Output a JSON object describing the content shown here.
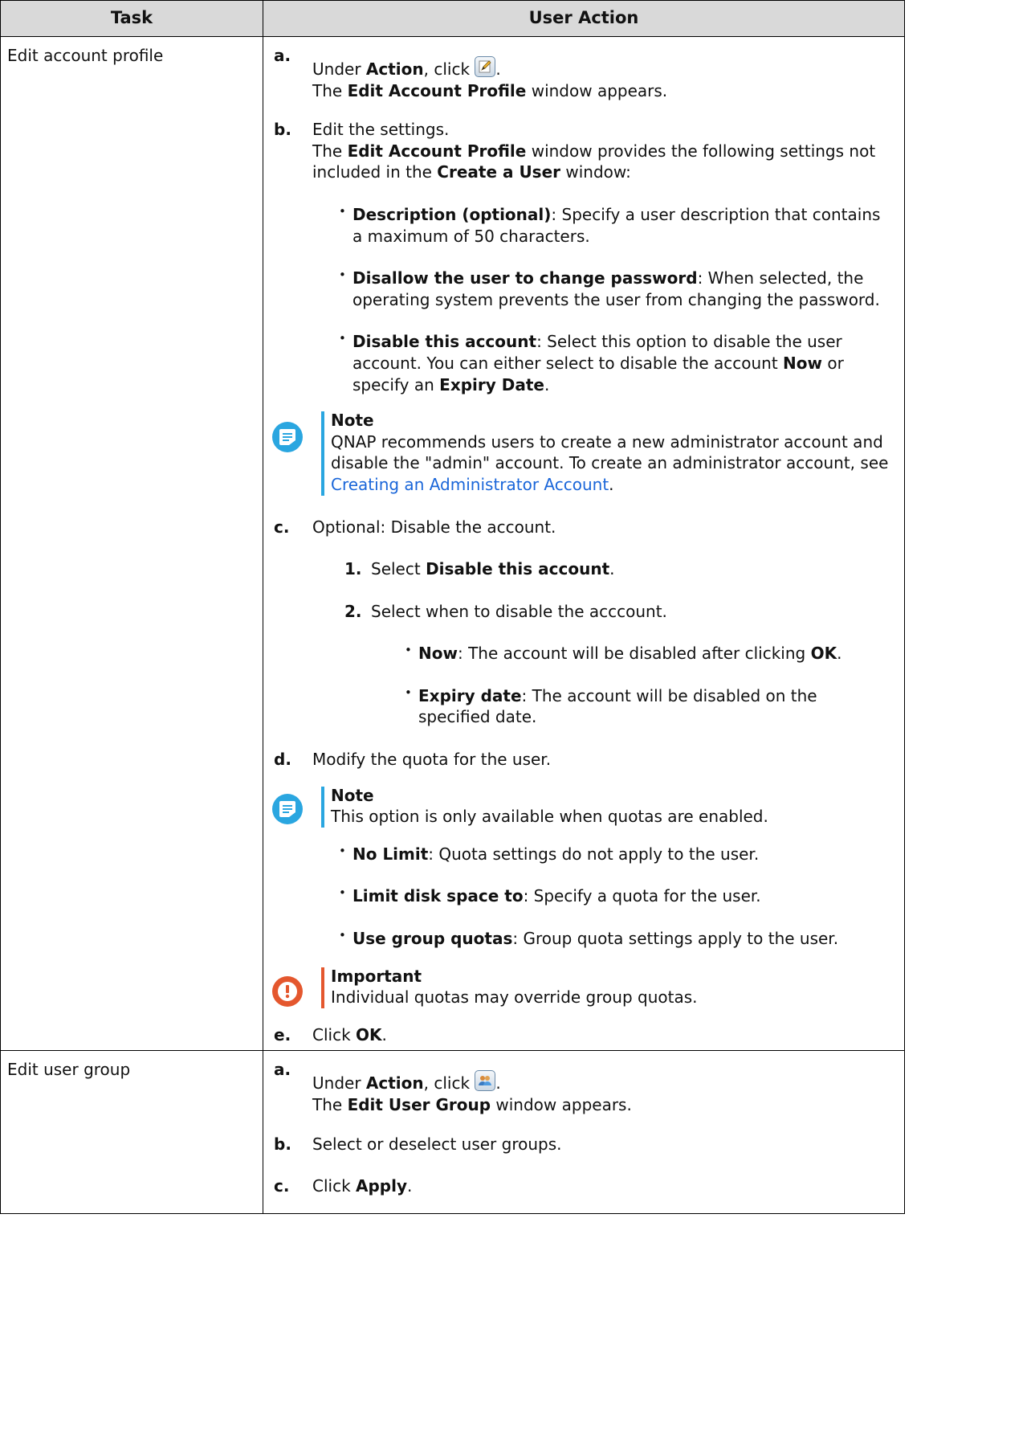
{
  "header": {
    "task": "Task",
    "action": "User Action"
  },
  "rows": [
    {
      "task": "Edit account profile",
      "step_a": {
        "label": "a.",
        "pre": "Under ",
        "bold": "Action",
        "post": ", click ",
        "end": ".",
        "icon": "edit-icon",
        "line2_bold": "Edit Account Profile",
        "line2_post": " window appears.",
        "line2_pre": "The "
      },
      "step_b": {
        "label": "b.",
        "text": "Edit the settings.",
        "line2_pre": "The ",
        "line2_bold1": "Edit Account Profile",
        "line2_mid": " window provides the following settings not included in the ",
        "line2_bold2": "Create a User",
        "line2_post": " window:",
        "bullets": [
          {
            "bold": "Description (optional)",
            "text": ": Specify a user description that contains a maximum of 50 characters."
          },
          {
            "bold": "Disallow the user to change password",
            "text": ": When selected, the operating system prevents the user from changing the password."
          },
          {
            "bold": "Disable this account",
            "text": ": Select this option to disable the user account. You can either select to disable the account ",
            "bold2": "Now",
            "text2": " or specify an ",
            "bold3": "Expiry Date",
            "text3": "."
          }
        ],
        "note": {
          "title": "Note",
          "text": "QNAP recommends users to create a new administrator account and disable the \"admin\" account. To create an administrator account, see ",
          "link": "Creating an Administrator Account",
          "end": "."
        }
      },
      "step_c": {
        "label": "c.",
        "text": "Optional: Disable the account.",
        "sub1": {
          "label": "1.",
          "pre": "Select ",
          "bold": "Disable this account",
          "post": "."
        },
        "sub2": {
          "label": "2.",
          "text": "Select when to disable the acccount."
        },
        "bullets": [
          {
            "bold": "Now",
            "text": ": The account will be disabled after clicking ",
            "bold2": "OK",
            "text2": "."
          },
          {
            "bold": "Expiry date",
            "text": ": The account will be disabled on the specified date."
          }
        ]
      },
      "step_d": {
        "label": "d.",
        "text": "Modify the quota for the user.",
        "note": {
          "title": "Note",
          "text": "This option is only available when quotas are enabled."
        },
        "bullets": [
          {
            "bold": "No Limit",
            "text": ": Quota settings do not apply to the user."
          },
          {
            "bold": "Limit disk space to",
            "text": ": Specify a quota for the user."
          },
          {
            "bold": "Use group quotas",
            "text": ": Group quota settings apply to the user."
          }
        ],
        "important": {
          "title": "Important",
          "text": "Individual quotas may override group quotas."
        }
      },
      "step_e": {
        "label": "e.",
        "pre": "Click ",
        "bold": "OK",
        "post": "."
      }
    },
    {
      "task": "Edit user group",
      "step_a": {
        "label": "a.",
        "pre": "Under ",
        "bold": "Action",
        "post": ", click ",
        "end": ".",
        "icon": "user-group-icon",
        "line2_pre": "The ",
        "line2_bold": "Edit User Group",
        "line2_post": " window appears."
      },
      "step_b": {
        "label": "b.",
        "text": "Select or deselect user groups."
      },
      "step_c": {
        "label": "c.",
        "pre": "Click ",
        "bold": "Apply",
        "post": "."
      }
    }
  ],
  "colors": {
    "note_accent": "#2aa6e0",
    "important_accent": "#e4572e",
    "link": "#1a66d9",
    "header_bg": "#d9d9d9"
  }
}
